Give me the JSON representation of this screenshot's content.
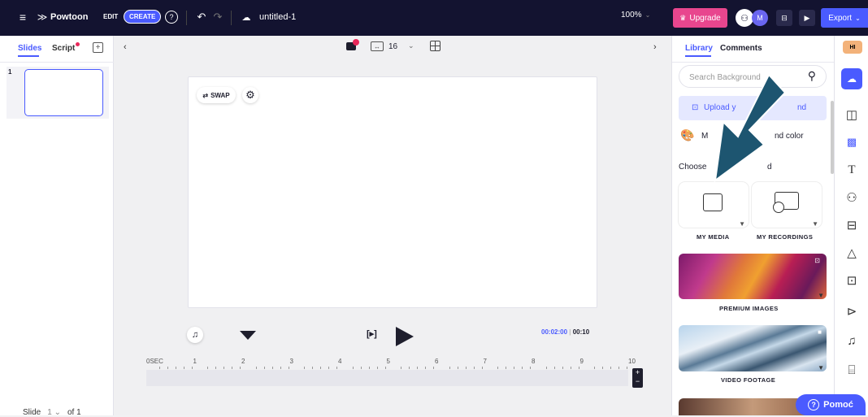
{
  "topbar": {
    "menu_icon": "hamburger-icon",
    "brand": "Powtoon",
    "edit_label": "EDIT",
    "create_label": "CREATE",
    "filename": "untitled-1",
    "zoom": "100%",
    "upgrade_label": "Upgrade",
    "avatar_initial": "M",
    "export_label": "Export"
  },
  "left": {
    "tab_slides": "Slides",
    "tab_script": "Script",
    "slide_number": "1",
    "footer_slide": "Slide",
    "footer_value": "1",
    "footer_of": "of 1"
  },
  "canvas_toolbar": {
    "spacing_value": "16"
  },
  "stage": {
    "swap_label": "SWAP"
  },
  "timeline": {
    "time_current": "00:02:00",
    "time_total": "00:10",
    "ticks": [
      "0SEC",
      "1",
      "2",
      "3",
      "4",
      "5",
      "6",
      "7",
      "8",
      "9",
      "10"
    ],
    "playhead_at_seconds": 2
  },
  "right": {
    "tab_library": "Library",
    "tab_comments": "Comments",
    "search_placeholder": "Search Background",
    "upload_label": "Upload y",
    "upload_label_tail": "nd",
    "color_label_head": "M",
    "color_label_tail": "nd color",
    "choose_label_head": "Choose",
    "choose_label_tail": "d",
    "my_media": "MY MEDIA",
    "my_recordings": "MY RECORDINGS",
    "premium_images": "PREMIUM IMAGES",
    "video_footage": "VIDEO FOOTAGE",
    "help_label": "Pomoć"
  },
  "rail": {
    "icons": [
      "upload-cloud-icon",
      "layout-icon",
      "background-pattern-icon",
      "text-icon",
      "characters-icon",
      "props-icon",
      "shapes-icon",
      "images-icon",
      "video-icon",
      "music-icon",
      "more-icon"
    ]
  },
  "colors": {
    "topbar_bg": "#131330",
    "accent": "#4a5bff",
    "upgrade": "#e8468e",
    "arrow": "#1d5570"
  }
}
